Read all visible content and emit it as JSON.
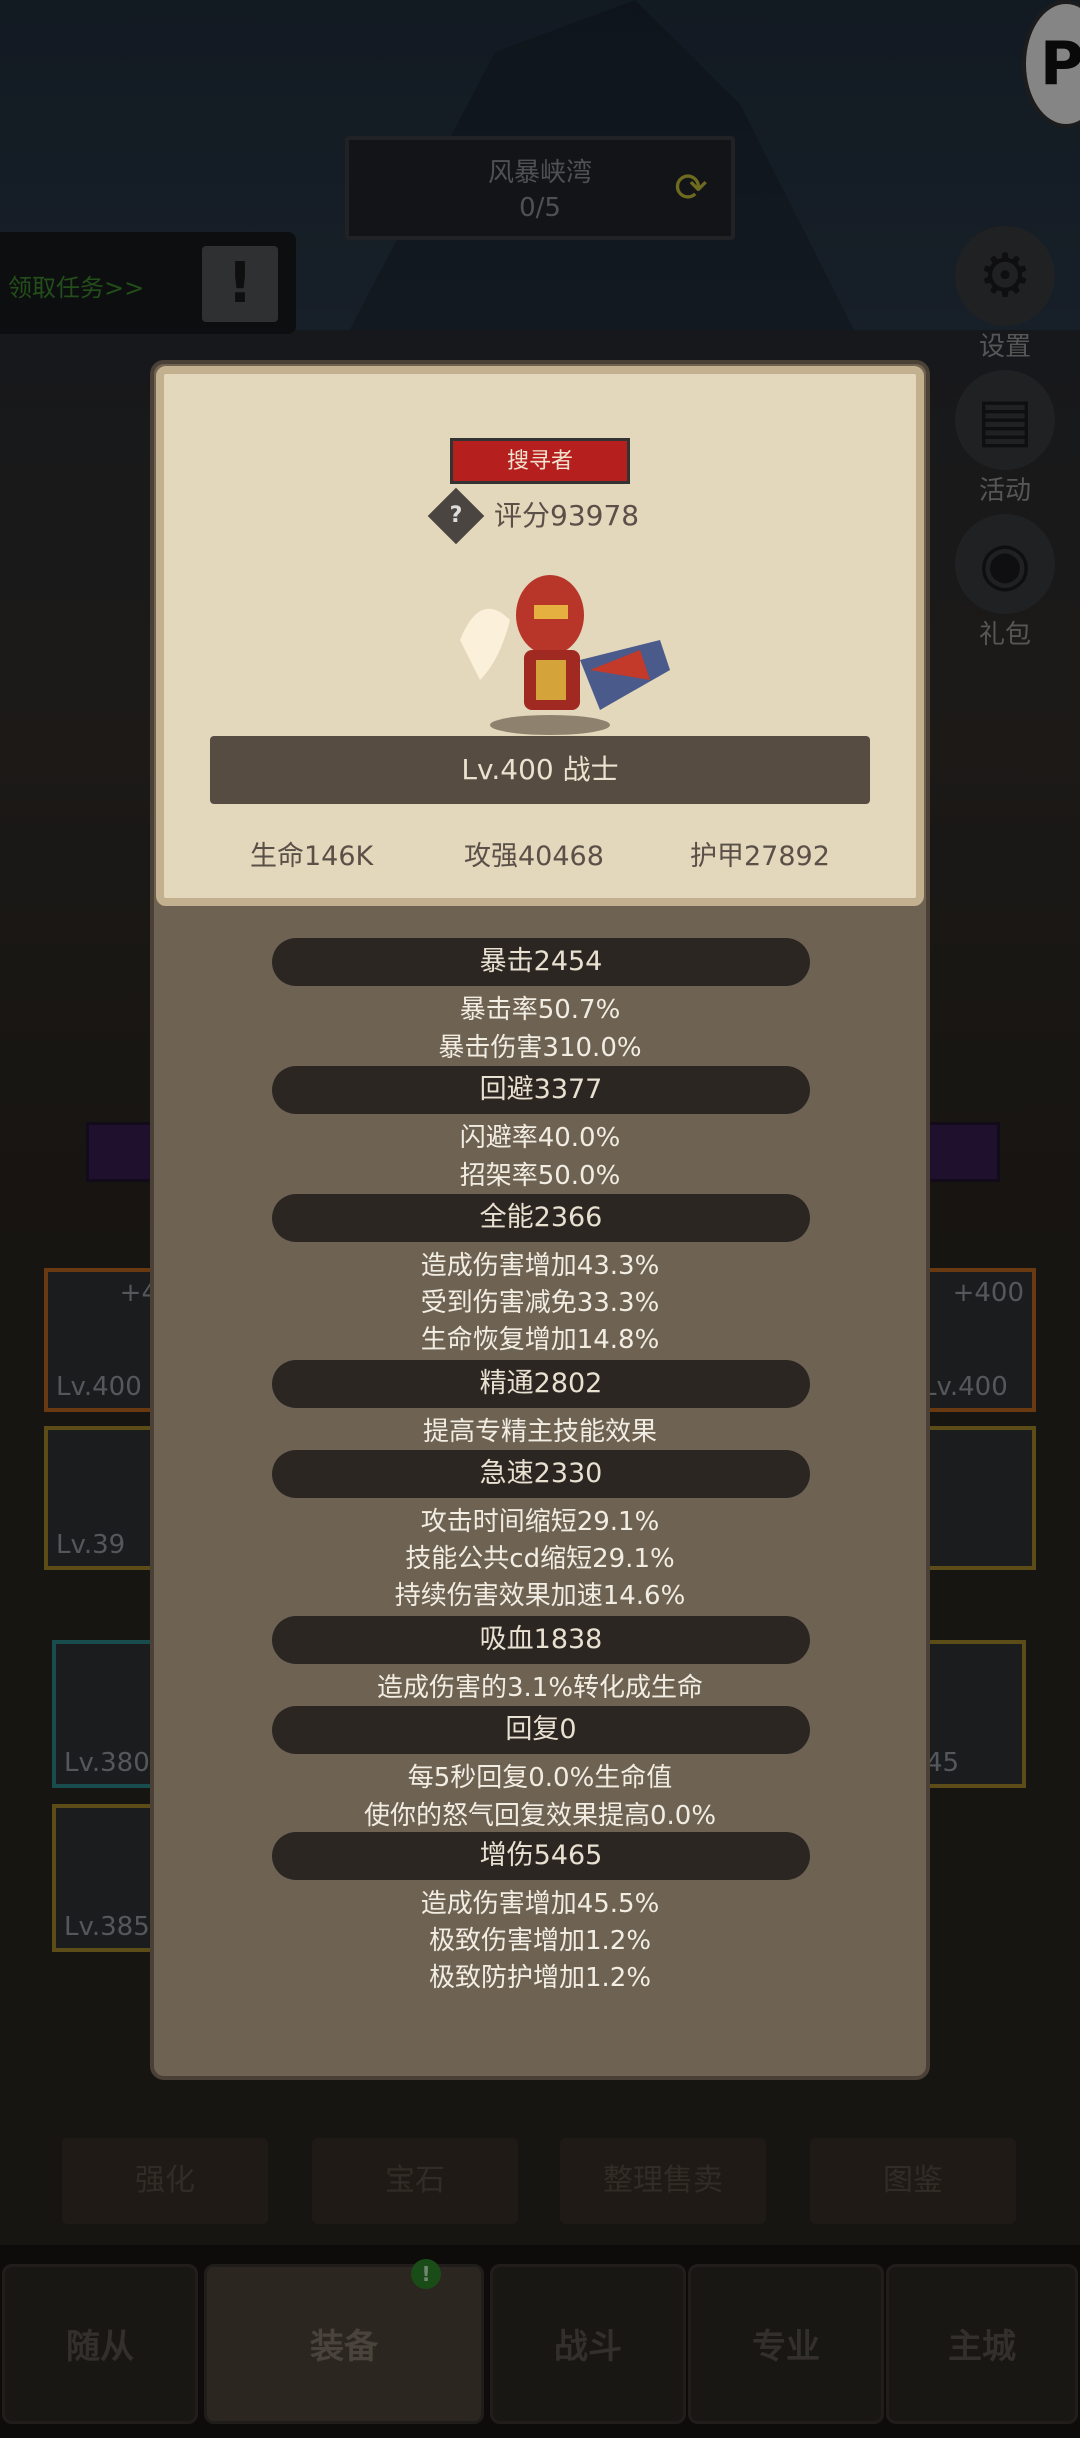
{
  "background": {
    "map_name": "风暴峡湾",
    "map_progress": "0/5",
    "task_label": "领取任务>>",
    "side_buttons": [
      "设置",
      "活动",
      "礼包"
    ],
    "slots": [
      {
        "level": "Lv.400",
        "plus": "+4"
      },
      {
        "level": "Lv.39"
      },
      {
        "level": "Lv.400",
        "plus": "+400"
      },
      {
        "level": "Lv.380"
      },
      {
        "level": "Lv.385"
      },
      {
        "level": "45"
      }
    ],
    "actions": [
      "强化",
      "宝石",
      "整理售卖",
      "图鉴"
    ],
    "nav": [
      {
        "label": "随从"
      },
      {
        "label": "装备",
        "active": true,
        "badge": "!"
      },
      {
        "label": "战斗"
      },
      {
        "label": "专业"
      },
      {
        "label": "主城"
      }
    ]
  },
  "card": {
    "class_badge": "搜寻者",
    "help_icon": "?",
    "score": "评分93978",
    "level_class": "Lv.400 战士",
    "hp": "生命146K",
    "atk": "攻强40468",
    "armor": "护甲27892"
  },
  "stats": [
    {
      "header": "暴击2454",
      "lines": [
        "暴击率50.7%",
        "暴击伤害310.0%"
      ]
    },
    {
      "header": "回避3377",
      "lines": [
        "闪避率40.0%",
        "招架率50.0%"
      ]
    },
    {
      "header": "全能2366",
      "lines": [
        "造成伤害增加43.3%",
        "受到伤害减免33.3%",
        "生命恢复增加14.8%"
      ]
    },
    {
      "header": "精通2802",
      "lines": [
        "提高专精主技能效果"
      ]
    },
    {
      "header": "急速2330",
      "lines": [
        "攻击时间缩短29.1%",
        "技能公共cd缩短29.1%",
        "持续伤害效果加速14.6%"
      ]
    },
    {
      "header": "吸血1838",
      "lines": [
        "造成伤害的3.1%转化成生命"
      ]
    },
    {
      "header": "回复0",
      "lines": [
        "每5秒回复0.0%生命值",
        "使你的怒气回复效果提高0.0%"
      ]
    },
    {
      "header": "增伤5465",
      "lines": [
        "造成伤害增加45.5%",
        "极致伤害增加1.2%",
        "极致防护增加1.2%"
      ]
    }
  ],
  "colors": {
    "badge_red": "#b5201e",
    "panel": "#6e6253",
    "card": "#e3d7bc"
  }
}
